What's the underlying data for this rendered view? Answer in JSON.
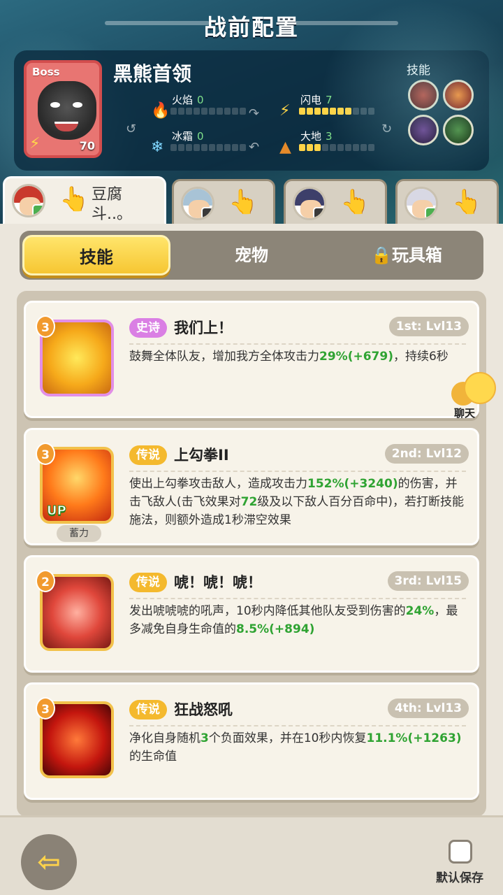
{
  "header": {
    "title": "战前配置"
  },
  "boss": {
    "tag": "Boss",
    "name": "黑熊首领",
    "level": "70",
    "elements": {
      "fire": {
        "label": "火焰",
        "value": "0",
        "level": 0
      },
      "lightning": {
        "label": "闪电",
        "value": "7",
        "level": 7
      },
      "ice": {
        "label": "冰霜",
        "value": "0",
        "level": 0
      },
      "earth": {
        "label": "大地",
        "value": "3",
        "level": 3
      }
    },
    "skills_label": "技能"
  },
  "heroes": [
    {
      "name": "豆腐斗..。",
      "active": true,
      "badge": "green",
      "hair": "#c9392c"
    },
    {
      "name": "",
      "active": false,
      "badge": "dark",
      "hair": "#a8c3d6"
    },
    {
      "name": "",
      "active": false,
      "badge": "dark",
      "hair": "#3d3f6a"
    },
    {
      "name": "",
      "active": false,
      "badge": "green",
      "hair": "#d8d8e4"
    }
  ],
  "segment": {
    "tab_skills": "技能",
    "tab_pets": "宠物",
    "tab_toybox": "玩具箱",
    "lock_icon": "lock-icon"
  },
  "skills": [
    {
      "rank": "3",
      "rarity": "史诗",
      "name": "我们上！",
      "slot": "1st: Lvl13",
      "desc_parts": [
        "鼓舞全体队友，增加我方全体攻击力",
        "29%",
        "(+679)",
        "，持续6秒"
      ]
    },
    {
      "rank": "3",
      "rarity": "传说",
      "name": "上勾拳II",
      "slot": "2nd: Lvl12",
      "up": "UP",
      "extra_tag": "蓄力",
      "desc_parts": [
        "使出上勾拳攻击敌人，造成攻击力",
        "152%",
        "(+3240)",
        "的伤害，并击飞敌人(击飞效果对",
        "72",
        "级及以下敌人百分百命中)，若打断技能施法，则额外造成1秒滞空效果"
      ]
    },
    {
      "rank": "2",
      "rarity": "传说",
      "name": "唬！唬！唬！",
      "slot": "3rd: Lvl15",
      "desc_parts": [
        "发出唬唬唬的吼声，10秒内降低其他队友受到伤害的",
        "24%",
        "，最多减免自身生命值的",
        "8.5%",
        "(+894)"
      ]
    },
    {
      "rank": "3",
      "rarity": "传说",
      "name": "狂战怒吼",
      "slot": "4th: Lvl13",
      "desc_parts": [
        "净化自身随机",
        "3",
        "个负面效果，并在10秒内恢复",
        "11.1%",
        "(+1263)",
        "的生命值"
      ]
    }
  ],
  "chat": {
    "label": "聊天"
  },
  "footer": {
    "back_icon": "back-arrow-icon",
    "default_save": "默认保存"
  }
}
